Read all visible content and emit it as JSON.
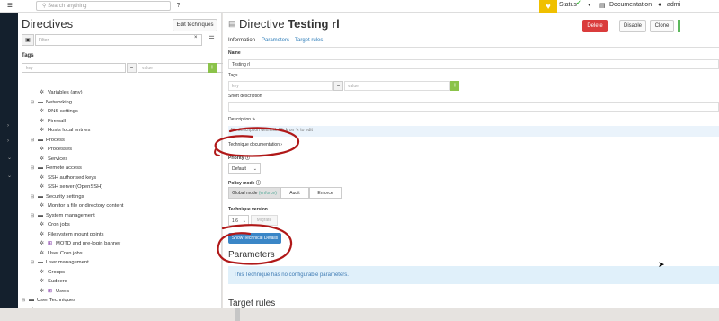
{
  "topbar": {
    "search_placeholder": "Search anything",
    "help": "?",
    "status_label": "Status",
    "documentation_label": "Documentation",
    "user_label": "admi"
  },
  "left": {
    "title": "Directives",
    "edit_techniques": "Edit techniques",
    "filter_placeholder": "Filter",
    "filter_clear": "×",
    "tags_label": "Tags",
    "tag_key_placeholder": "key",
    "tag_equals": "=",
    "tag_value_placeholder": "value",
    "tag_add": "+"
  },
  "tree": [
    {
      "label": "Variables (any)",
      "kind": "tech",
      "level": 2
    },
    {
      "label": "Networking",
      "kind": "cat",
      "level": 1
    },
    {
      "label": "DNS settings",
      "kind": "tech",
      "level": 2
    },
    {
      "label": "Firewall",
      "kind": "tech",
      "level": 2
    },
    {
      "label": "Hosts local entries",
      "kind": "tech",
      "level": 2
    },
    {
      "label": "Process",
      "kind": "cat",
      "level": 1
    },
    {
      "label": "Processes",
      "kind": "tech",
      "level": 2
    },
    {
      "label": "Services",
      "kind": "tech",
      "level": 2
    },
    {
      "label": "Remote access",
      "kind": "cat",
      "level": 1
    },
    {
      "label": "SSH authorised keys",
      "kind": "tech",
      "level": 2
    },
    {
      "label": "SSH server (OpenSSH)",
      "kind": "tech",
      "level": 2
    },
    {
      "label": "Security settings",
      "kind": "cat",
      "level": 1
    },
    {
      "label": "Monitor a file or directory content",
      "kind": "tech",
      "level": 2
    },
    {
      "label": "System management",
      "kind": "cat",
      "level": 1
    },
    {
      "label": "Cron jobs",
      "kind": "tech",
      "level": 2
    },
    {
      "label": "Filesystem mount points",
      "kind": "tech",
      "level": 2
    },
    {
      "label": "MOTD and pre-login banner",
      "kind": "win",
      "level": 2
    },
    {
      "label": "User Cron jobs",
      "kind": "tech",
      "level": 2
    },
    {
      "label": "User management",
      "kind": "cat",
      "level": 1
    },
    {
      "label": "Groups",
      "kind": "tech",
      "level": 2
    },
    {
      "label": "Sudoers",
      "kind": "tech",
      "level": 2
    },
    {
      "label": "Users",
      "kind": "win",
      "level": 2
    },
    {
      "label": "User Techniques",
      "kind": "cat",
      "level": 0
    },
    {
      "label": "Install firefox",
      "kind": "win",
      "level": 1
    }
  ],
  "directive": {
    "title_prefix": "Directive",
    "title_name": "Testing rl",
    "delete": "Delete",
    "disable": "Disable",
    "clone": "Clone",
    "tabs": [
      "Information",
      "Parameters",
      "Target rules"
    ],
    "name_label": "Name",
    "name_value": "Testing rl",
    "tags_label": "Tags",
    "tag_key_placeholder": "key",
    "tag_equals": "=",
    "tag_value_placeholder": "value",
    "tag_add": "+",
    "short_desc_label": "Short description",
    "description_label": "Description",
    "description_placeholder": "No description defined. Click on ✎ to edit",
    "technique_doc": "Technique documentation",
    "priority_label": "Priority",
    "priority_value": "Default",
    "policy_mode_label": "Policy mode",
    "mode_global": "Global mode",
    "mode_global_sub": "(enforce)",
    "mode_audit": "Audit",
    "mode_enforce": "Enforce",
    "technique_version_label": "Technique version",
    "version_value": "1.6",
    "migrate": "Migrate",
    "show_tech_details": "Show Technical Details",
    "parameters_title": "Parameters",
    "parameters_info": "This Technique has no configurable parameters.",
    "target_rules_title": "Target rules"
  },
  "colors": {
    "accent": "#2a7bb8",
    "delete": "#da3c3c",
    "status": "#f0c000",
    "add": "#8bc34a",
    "annotation": "#b01818"
  },
  "icons": {
    "menu": "menu-icon",
    "help": "help-icon",
    "status": "heart-icon",
    "documentation": "book-icon",
    "user": "user-icon",
    "directive_doc": "document-icon",
    "category": "folder-icon",
    "technique": "gear-icon",
    "windows_technique": "windows-icon"
  }
}
